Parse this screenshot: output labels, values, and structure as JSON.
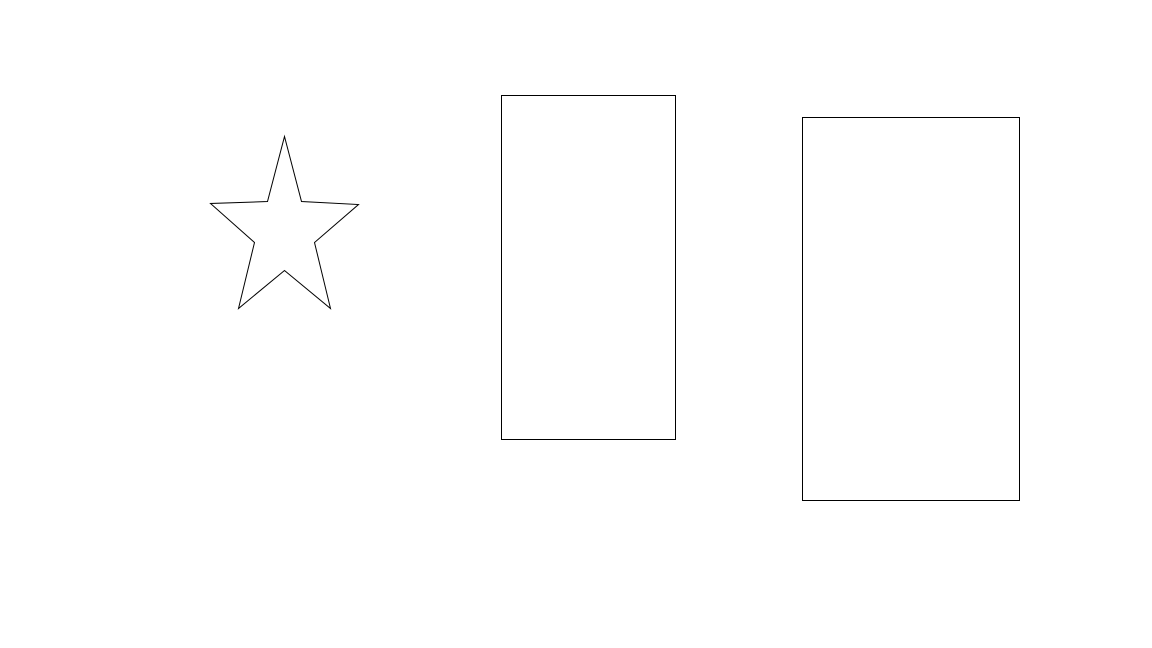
{
  "canvas": {
    "background": "#ffffff",
    "stroke": "#000000",
    "fill": "#ffffff"
  },
  "shapes": [
    {
      "type": "star",
      "points": 5,
      "icon": "star-icon"
    },
    {
      "type": "rectangle",
      "icon": "rectangle-icon"
    },
    {
      "type": "rectangle",
      "icon": "rectangle-icon"
    }
  ]
}
